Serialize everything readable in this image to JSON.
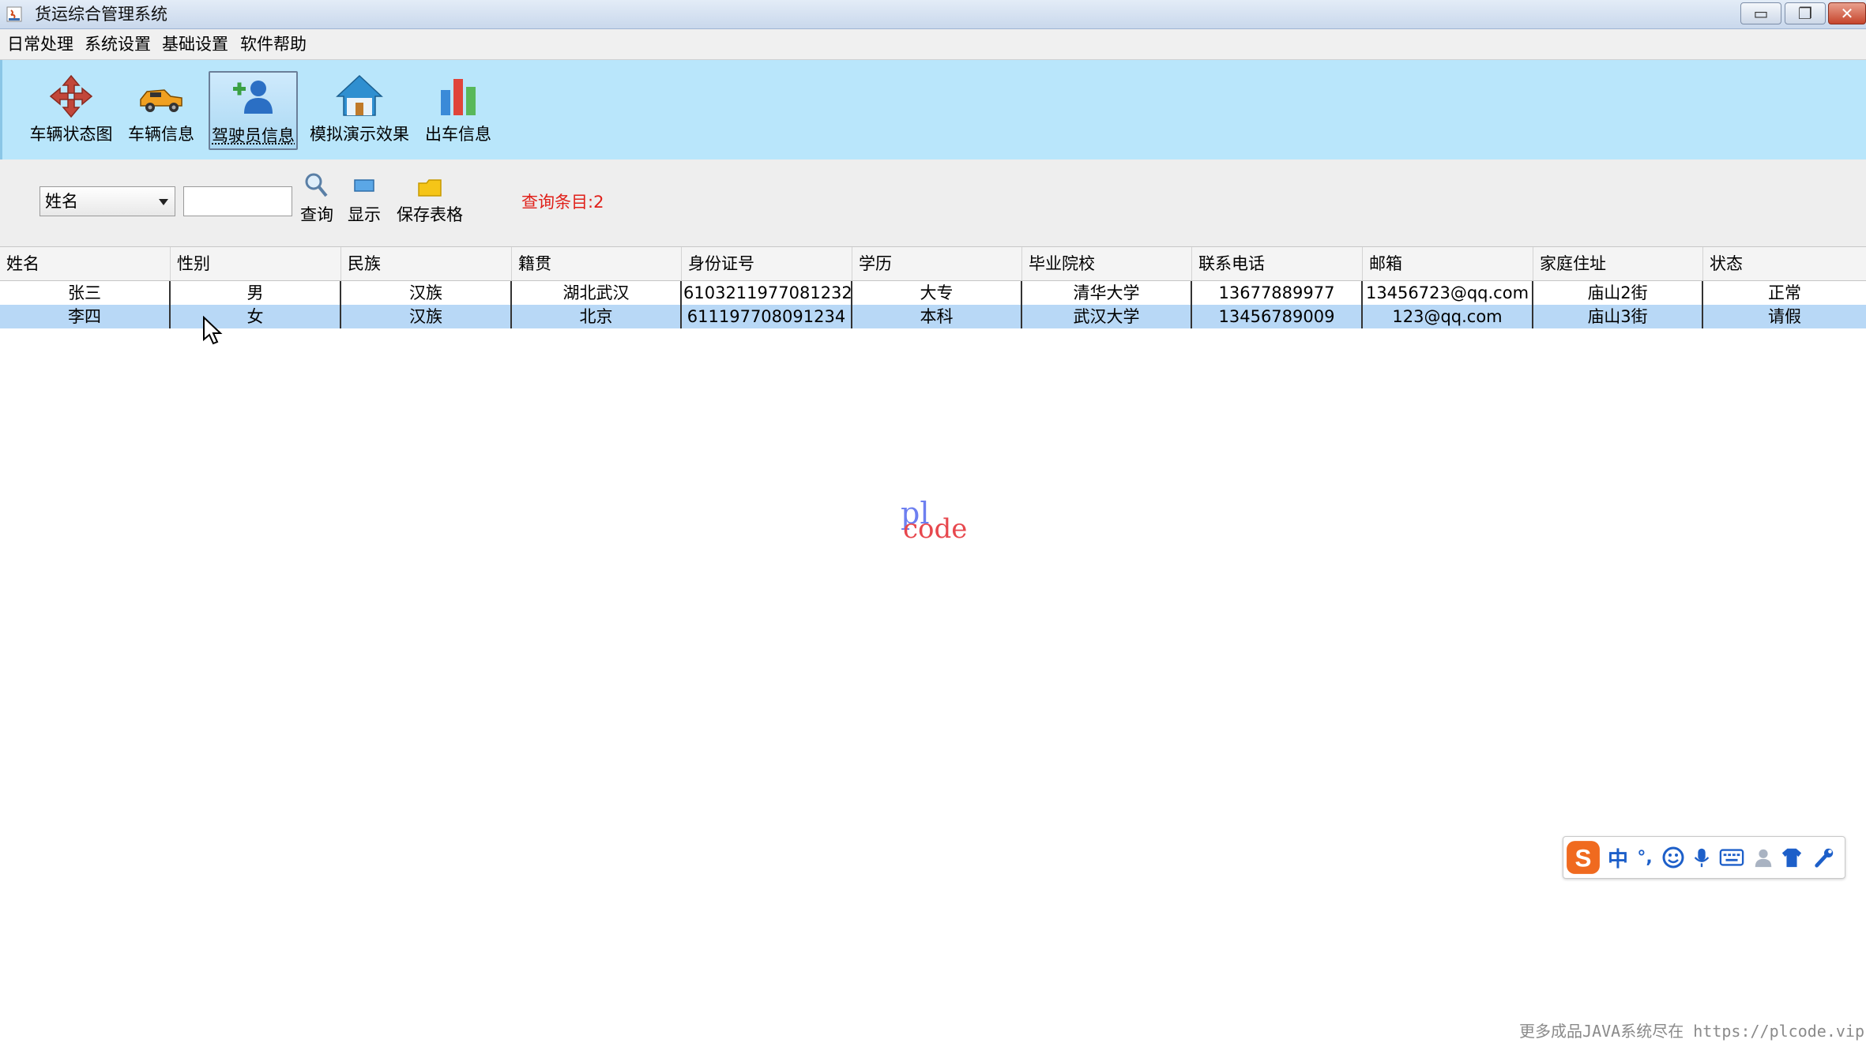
{
  "window": {
    "title": "货运综合管理系统",
    "minimize": "▭",
    "restore": "❐",
    "close": "✕"
  },
  "menu": [
    "日常处理",
    "系统设置",
    "基础设置",
    "软件帮助"
  ],
  "toolbar": {
    "items": [
      {
        "label": "车辆状态图",
        "icon": "move-arrows-icon"
      },
      {
        "label": "车辆信息",
        "icon": "truck-icon"
      },
      {
        "label": "驾驶员信息",
        "icon": "add-user-icon"
      },
      {
        "label": "模拟演示效果",
        "icon": "house-icon"
      },
      {
        "label": "出车信息",
        "icon": "bar-chart-icon"
      }
    ],
    "active_index": 2
  },
  "search": {
    "field_selected": "姓名",
    "query_value": "",
    "query_label": "查询",
    "show_label": "显示",
    "save_label": "保存表格",
    "count_text": "查询条目:2"
  },
  "table": {
    "columns": [
      "姓名",
      "性别",
      "民族",
      "籍贯",
      "身份证号",
      "学历",
      "毕业院校",
      "联系电话",
      "邮箱",
      "家庭住址",
      "状态"
    ],
    "rows": [
      [
        "张三",
        "男",
        "汉族",
        "湖北武汉",
        "6103211977081232...",
        "大专",
        "清华大学",
        "13677889977",
        "13456723@qq.com",
        "庙山2街",
        "正常"
      ],
      [
        "李四",
        "女",
        "汉族",
        "北京",
        "611197708091234",
        "本科",
        "武汉大学",
        "13456789009",
        "123@qq.com",
        "庙山3街",
        "请假"
      ]
    ],
    "selected_row": 1
  },
  "watermark": {
    "top": "pl",
    "bottom": "code"
  },
  "ime": {
    "logo": "S",
    "mode": "中",
    "punct": "°,"
  },
  "footer": "更多成品JAVA系统尽在 https://plcode.vip",
  "colors": {
    "toolbar_bg": "#b9e6fb",
    "count_red": "#e0201a",
    "selected_row": "#b8d8f6"
  }
}
